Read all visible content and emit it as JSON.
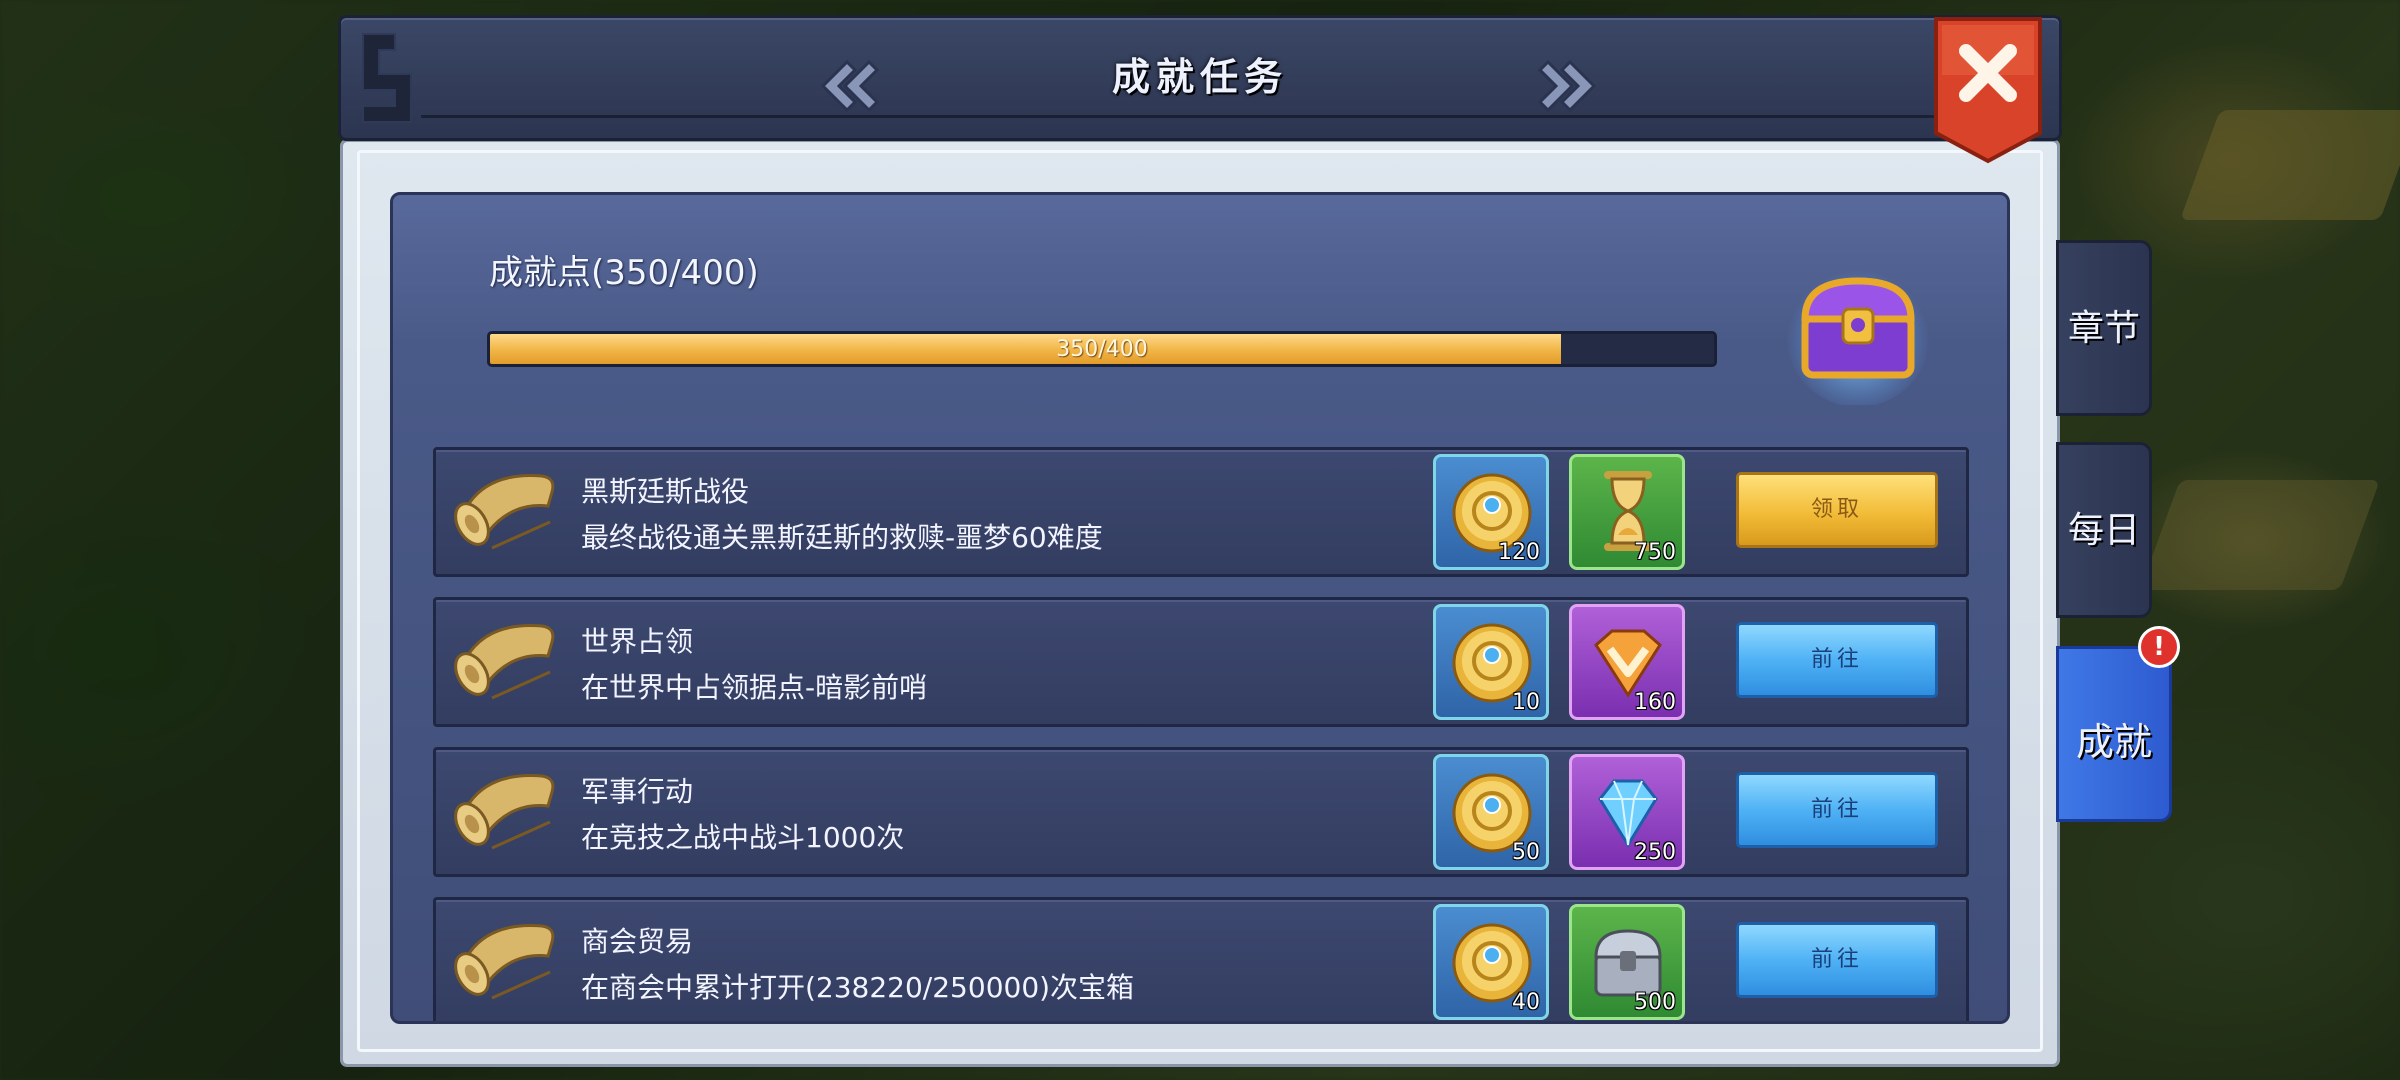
{
  "header": {
    "title": "成就任务"
  },
  "progress": {
    "label": "成就点(350/400)",
    "bar_text": "350/400",
    "current": 350,
    "max": 400
  },
  "tasks": [
    {
      "title": "黑斯廷斯战役",
      "desc": "最终战役通关黑斯廷斯的救赎-噩梦60难度",
      "reward1": {
        "icon": "coin-icon",
        "count": "120"
      },
      "reward2": {
        "icon": "hourglass-icon",
        "count": "750",
        "color": "green"
      },
      "button": {
        "label": "领取",
        "type": "claim"
      }
    },
    {
      "title": "世界占领",
      "desc": "在世界中占领据点-暗影前哨",
      "reward1": {
        "icon": "coin-icon",
        "count": "10"
      },
      "reward2": {
        "icon": "rank-emblem-icon",
        "count": "160",
        "color": "purple"
      },
      "button": {
        "label": "前往",
        "type": "go"
      }
    },
    {
      "title": "军事行动",
      "desc": "在竞技之战中战斗1000次",
      "reward1": {
        "icon": "coin-icon",
        "count": "50"
      },
      "reward2": {
        "icon": "diamond-icon",
        "count": "250",
        "color": "purple"
      },
      "button": {
        "label": "前往",
        "type": "go"
      }
    },
    {
      "title": "商会贸易",
      "desc": "在商会中累计打开(238220/250000)次宝箱",
      "reward1": {
        "icon": "coin-icon",
        "count": "40"
      },
      "reward2": {
        "icon": "silver-chest-icon",
        "count": "500",
        "color": "green"
      },
      "button": {
        "label": "前往",
        "type": "go"
      }
    }
  ],
  "side_tabs": [
    {
      "label": "章节",
      "active": false
    },
    {
      "label": "每日",
      "active": false
    },
    {
      "label": "成就",
      "active": true,
      "badge": "!"
    }
  ],
  "colors": {
    "accent_gold": "#f2b84a",
    "go_button": "#4fb2f5",
    "active_tab": "#3f78e6",
    "close_red": "#d8432a"
  }
}
